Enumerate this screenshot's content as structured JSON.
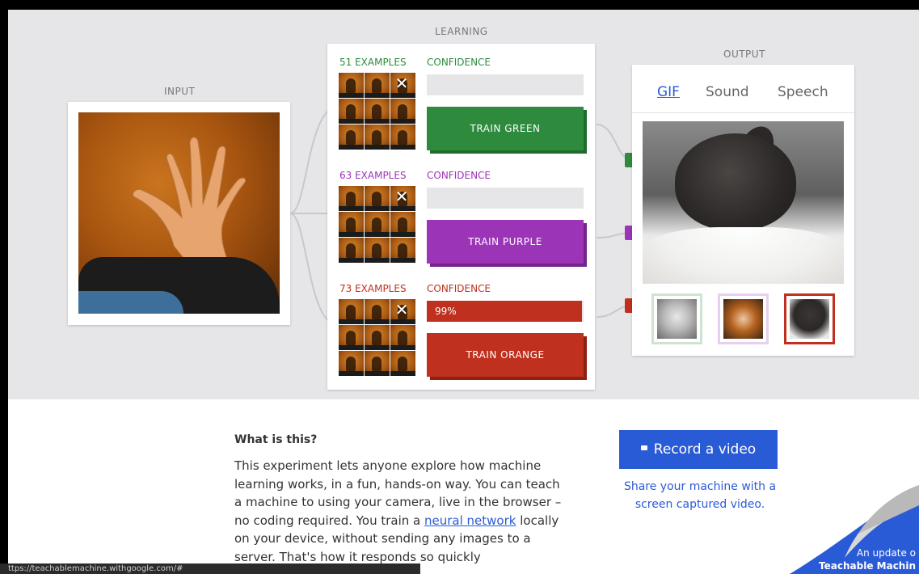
{
  "sections": {
    "input": "INPUT",
    "learning": "LEARNING",
    "output": "OUTPUT"
  },
  "classes": [
    {
      "examples": "51 EXAMPLES",
      "confidence_label": "CONFIDENCE",
      "confidence_value": "",
      "confidence_fraction": 0.0,
      "button": "TRAIN GREEN",
      "color": "#2e8b3e",
      "shade": "#1f6b2c"
    },
    {
      "examples": "63 EXAMPLES",
      "confidence_label": "CONFIDENCE",
      "confidence_value": "",
      "confidence_fraction": 0.0,
      "button": "TRAIN PURPLE",
      "color": "#9c34b8",
      "shade": "#74258a"
    },
    {
      "examples": "73 EXAMPLES",
      "confidence_label": "CONFIDENCE",
      "confidence_value": "99%",
      "confidence_fraction": 0.99,
      "button": "TRAIN ORANGE",
      "color": "#c0301e",
      "shade": "#8e2013"
    }
  ],
  "output": {
    "tabs": [
      "GIF",
      "Sound",
      "Speech"
    ],
    "active_tab": "GIF",
    "thumb_colors": [
      "#2e8b3e",
      "#9c34b8",
      "#c0301e"
    ]
  },
  "info": {
    "title": "What is this?",
    "body_1": "This experiment lets anyone explore how machine learning works, in a fun, hands-on way. You can teach a machine to using your camera, live in the browser – no coding required. You train a ",
    "link_1": "neural network",
    "body_2": " locally on your device, without sending any images to a server. That's how it responds so quickly"
  },
  "record": {
    "button": "Record a video",
    "share": "Share your machine with a screen captured video."
  },
  "corner": {
    "line1": "An update o",
    "line2": "Teachable Machin"
  },
  "status_url": "ttps://teachablemachine.withgoogle.com/#"
}
